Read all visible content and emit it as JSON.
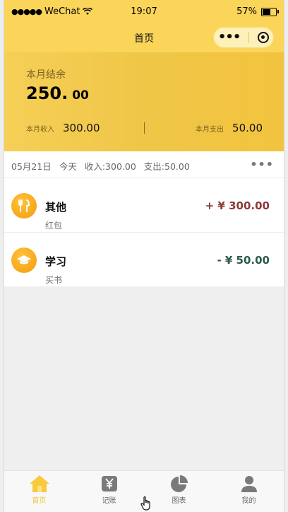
{
  "status_bar": {
    "signal": "●●●●●",
    "carrier": "WeChat",
    "time": "19:07",
    "battery": "57%",
    "battery_level": 0.57
  },
  "navbar": {
    "title": "首页",
    "more": "•••"
  },
  "summary": {
    "label": "本月结余",
    "balance_int": "250.",
    "balance_dec": "00",
    "income_label": "本月收入",
    "income_value": "300.00",
    "expense_label": "本月支出",
    "expense_value": "50.00"
  },
  "day": {
    "date": "05月21日",
    "relative": "今天",
    "income": "收入:300.00",
    "expense": "支出:50.00",
    "more": "•••"
  },
  "records": [
    {
      "category": "其他",
      "note": "红包",
      "amount": "+ ¥ 300.00",
      "type": "income",
      "icon": "fork-knife-icon"
    },
    {
      "category": "学习",
      "note": "买书",
      "amount": "- ¥ 50.00",
      "type": "expense",
      "icon": "graduation-cap-icon"
    }
  ],
  "tabs": [
    {
      "label": "首页",
      "icon": "home-icon",
      "active": true
    },
    {
      "label": "记账",
      "icon": "yen-icon",
      "active": false
    },
    {
      "label": "图表",
      "icon": "pie-chart-icon",
      "active": false
    },
    {
      "label": "我的",
      "icon": "user-icon",
      "active": false
    }
  ],
  "colors": {
    "accent": "#fbd55a",
    "active_tab": "#f2c53c",
    "income_amount": "#8b3a3a",
    "expense_amount": "#2b5a4e"
  }
}
